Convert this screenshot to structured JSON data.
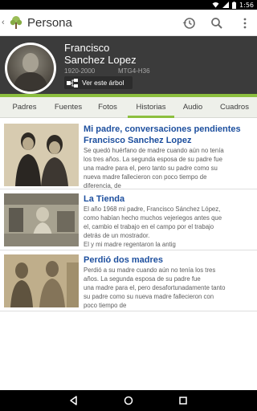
{
  "status_bar": {
    "time": "1:56",
    "icons": [
      "wifi-icon",
      "cell-signal-icon",
      "battery-icon"
    ]
  },
  "app_bar": {
    "title": "Persona",
    "icons": [
      "back-chevron-icon",
      "app-logo-tree-icon",
      "history-icon",
      "search-icon",
      "more-vertical-icon"
    ]
  },
  "person": {
    "name_line1": "Francisco",
    "name_line2": "Sanchez Lopez",
    "dates": "1920-2000",
    "id": "MTG4-H36",
    "tree_button_label": "Ver este árbol"
  },
  "tabs": [
    {
      "label": "Padres",
      "active": false
    },
    {
      "label": "Fuentes",
      "active": false
    },
    {
      "label": "Fotos",
      "active": false
    },
    {
      "label": "Historias",
      "active": true
    },
    {
      "label": "Audio",
      "active": false
    },
    {
      "label": "Cuadros",
      "active": false
    }
  ],
  "stories": [
    {
      "title_line1": "Mi padre, conversaciones pendientes",
      "title_line2": "Francisco Sanchez Lopez",
      "text": [
        "Se quedó huérfano de madre cuando aún no tenía",
        "los tres años. La segunda esposa de su padre fue",
        "una madre para el, pero tanto su padre como su",
        "nueva madre fallecieron con poco tiempo de",
        "diferencia, de"
      ]
    },
    {
      "title_line1": "La Tienda",
      "text": [
        "El año 1968 mi padre, Francisco Sánchez López,",
        "como habían hecho muchos vejeriegos antes que",
        "el, cambio el trabajo en el campo por el trabajo",
        "detrás de un mostrador.",
        "El y mi madre regentaron la antig"
      ]
    },
    {
      "title_line1": "Perdió dos madres",
      "text": [
        "Perdió a su madre cuando aún no tenía los tres",
        "años. La segunda esposa de su padre fue",
        "una madre para el, pero desafortunadamente tanto",
        "su padre como su nueva madre fallecieron con",
        "poco tiempo de"
      ]
    }
  ],
  "colors": {
    "accent_green": "#8cbf3f",
    "title_blue": "#1d4f9e",
    "header_bg": "#3b3b3b"
  },
  "nav_bar": {
    "icons": [
      "nav-back-icon",
      "nav-home-icon",
      "nav-recents-icon"
    ]
  }
}
